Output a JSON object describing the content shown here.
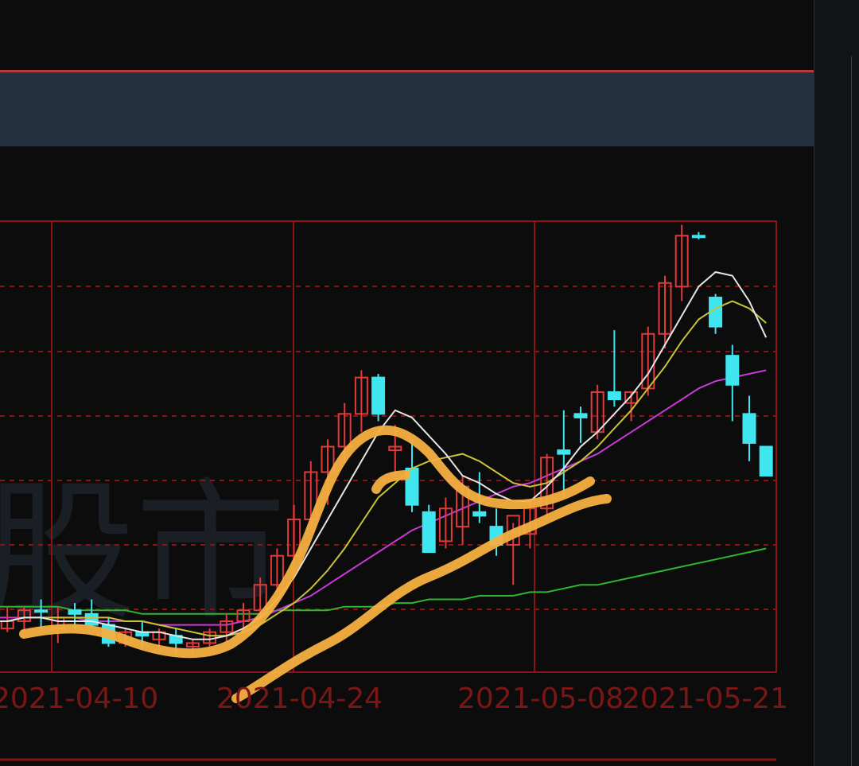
{
  "watermark": "股市",
  "chart_data": {
    "type": "candlestick",
    "x_tick_labels": [
      "2021-04-10",
      "2021-04-24",
      "2021-05-08",
      "2021-05-21"
    ],
    "colors": {
      "up": "#e03a3a",
      "down": "#3fe6f0",
      "ma5": "#e6e6e6",
      "ma10": "#c9c23a",
      "ma20": "#c63ad6",
      "ma60": "#2fb52f",
      "annotation": "#f5b041",
      "grid": "#8a1414"
    },
    "ylim": [
      0,
      100
    ],
    "grid": true,
    "candles": [
      {
        "o": 8,
        "h": 10,
        "l": 4,
        "c": 7,
        "dir": "up"
      },
      {
        "o": 8,
        "h": 12,
        "l": 5,
        "c": 6,
        "dir": "up"
      },
      {
        "o": 8,
        "h": 12,
        "l": 5,
        "c": 11,
        "dir": "up"
      },
      {
        "o": 11,
        "h": 14,
        "l": 6,
        "c": 11,
        "dir": "down"
      },
      {
        "o": 9,
        "h": 12,
        "l": 2,
        "c": 6,
        "dir": "up"
      },
      {
        "o": 11,
        "h": 13,
        "l": 6,
        "c": 10,
        "dir": "down"
      },
      {
        "o": 10,
        "h": 14,
        "l": 6,
        "c": 7,
        "dir": "down"
      },
      {
        "o": 7,
        "h": 9,
        "l": 1,
        "c": 2,
        "dir": "down"
      },
      {
        "o": 2,
        "h": 6,
        "l": 1,
        "c": 5,
        "dir": "up"
      },
      {
        "o": 5,
        "h": 8,
        "l": 1,
        "c": 4,
        "dir": "down"
      },
      {
        "o": 3,
        "h": 6,
        "l": 1,
        "c": 5,
        "dir": "up"
      },
      {
        "o": 4,
        "h": 6,
        "l": -1,
        "c": 2,
        "dir": "down"
      },
      {
        "o": 1,
        "h": 3,
        "l": -1,
        "c": 2,
        "dir": "up"
      },
      {
        "o": 2,
        "h": 6,
        "l": 1,
        "c": 5,
        "dir": "up"
      },
      {
        "o": 5,
        "h": 10,
        "l": 2,
        "c": 8,
        "dir": "up"
      },
      {
        "o": 8,
        "h": 13,
        "l": 5,
        "c": 11,
        "dir": "up"
      },
      {
        "o": 11,
        "h": 20,
        "l": 9,
        "c": 18,
        "dir": "up"
      },
      {
        "o": 18,
        "h": 28,
        "l": 16,
        "c": 26,
        "dir": "up"
      },
      {
        "o": 26,
        "h": 40,
        "l": 24,
        "c": 36,
        "dir": "up"
      },
      {
        "o": 36,
        "h": 52,
        "l": 34,
        "c": 49,
        "dir": "up"
      },
      {
        "o": 49,
        "h": 58,
        "l": 40,
        "c": 56,
        "dir": "up"
      },
      {
        "o": 56,
        "h": 68,
        "l": 52,
        "c": 65,
        "dir": "up"
      },
      {
        "o": 65,
        "h": 77,
        "l": 60,
        "c": 75,
        "dir": "up"
      },
      {
        "o": 75,
        "h": 76,
        "l": 63,
        "c": 65,
        "dir": "down"
      },
      {
        "o": 55,
        "h": 62,
        "l": 48,
        "c": 56,
        "dir": "up"
      },
      {
        "o": 50,
        "h": 58,
        "l": 38,
        "c": 40,
        "dir": "down"
      },
      {
        "o": 38,
        "h": 40,
        "l": 27,
        "c": 27,
        "dir": "down"
      },
      {
        "o": 30,
        "h": 42,
        "l": 28,
        "c": 39,
        "dir": "up"
      },
      {
        "o": 34,
        "h": 48,
        "l": 29,
        "c": 45,
        "dir": "up"
      },
      {
        "o": 37,
        "h": 49,
        "l": 35,
        "c": 38,
        "dir": "down"
      },
      {
        "o": 34,
        "h": 39,
        "l": 26,
        "c": 29,
        "dir": "down"
      },
      {
        "o": 29,
        "h": 35,
        "l": 18,
        "c": 37,
        "dir": "up"
      },
      {
        "o": 32,
        "h": 41,
        "l": 28,
        "c": 39,
        "dir": "up"
      },
      {
        "o": 39,
        "h": 54,
        "l": 36,
        "c": 53,
        "dir": "up"
      },
      {
        "o": 54,
        "h": 66,
        "l": 42,
        "c": 55,
        "dir": "down"
      },
      {
        "o": 65,
        "h": 67,
        "l": 57,
        "c": 64,
        "dir": "down"
      },
      {
        "o": 60,
        "h": 73,
        "l": 58,
        "c": 71,
        "dir": "up"
      },
      {
        "o": 71,
        "h": 88,
        "l": 67,
        "c": 69,
        "dir": "down"
      },
      {
        "o": 68,
        "h": 71,
        "l": 63,
        "c": 71,
        "dir": "up"
      },
      {
        "o": 72,
        "h": 89,
        "l": 70,
        "c": 87,
        "dir": "up"
      },
      {
        "o": 87,
        "h": 103,
        "l": 83,
        "c": 101,
        "dir": "up"
      },
      {
        "o": 100,
        "h": 117,
        "l": 96,
        "c": 114,
        "dir": "up"
      },
      {
        "o": 114,
        "h": 115,
        "l": 113,
        "c": 114,
        "dir": "down"
      },
      {
        "o": 97,
        "h": 98,
        "l": 87,
        "c": 89,
        "dir": "down"
      },
      {
        "o": 81,
        "h": 84,
        "l": 63,
        "c": 73,
        "dir": "down"
      },
      {
        "o": 65,
        "h": 70,
        "l": 52,
        "c": 57,
        "dir": "down"
      },
      {
        "o": 56,
        "h": 56,
        "l": 48,
        "c": 48,
        "dir": "down"
      }
    ],
    "ma5": [
      8,
      8,
      9,
      9,
      8,
      8,
      8,
      7,
      6,
      5,
      5,
      4,
      3,
      3,
      4,
      6,
      9,
      14,
      20,
      28,
      36,
      44,
      52,
      60,
      66,
      64,
      59,
      54,
      48,
      46,
      43,
      41,
      41,
      45,
      50,
      56,
      60,
      65,
      70,
      76,
      84,
      92,
      100,
      104,
      103,
      96,
      86
    ],
    "ma10": [
      8,
      8,
      9,
      9,
      9,
      9,
      9,
      9,
      8,
      8,
      7,
      6,
      5,
      4,
      4,
      5,
      7,
      10,
      13,
      17,
      22,
      28,
      35,
      42,
      46,
      50,
      52,
      53,
      54,
      52,
      49,
      46,
      45,
      46,
      49,
      52,
      56,
      61,
      66,
      72,
      78,
      85,
      91,
      94,
      96,
      94,
      90
    ],
    "ma20": [
      9,
      9,
      9,
      9,
      9,
      9,
      8,
      8,
      8,
      8,
      7,
      7,
      7,
      7,
      7,
      8,
      9,
      11,
      13,
      15,
      18,
      21,
      24,
      27,
      30,
      33,
      35,
      37,
      39,
      41,
      43,
      45,
      46,
      48,
      50,
      52,
      54,
      57,
      60,
      63,
      66,
      69,
      72,
      74,
      75,
      76,
      77
    ],
    "ma60": [
      12,
      12,
      12,
      12,
      12,
      11,
      11,
      11,
      11,
      10,
      10,
      10,
      10,
      10,
      10,
      10,
      10,
      11,
      11,
      11,
      11,
      12,
      12,
      12,
      13,
      13,
      14,
      14,
      14,
      15,
      15,
      15,
      16,
      16,
      17,
      18,
      18,
      19,
      20,
      21,
      22,
      23,
      24,
      25,
      26,
      27,
      28
    ]
  }
}
